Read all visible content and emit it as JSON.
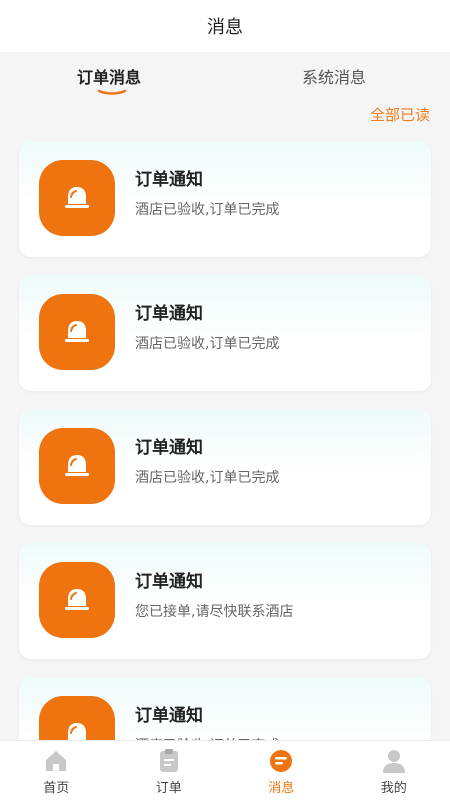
{
  "header": {
    "title": "消息"
  },
  "tabs": [
    {
      "label": "订单消息",
      "active": true
    },
    {
      "label": "系统消息",
      "active": false
    }
  ],
  "mark_all_read": "全部已读",
  "messages": [
    {
      "title": "订单通知",
      "desc": "酒店已验收,订单已完成",
      "icon": "bell-icon"
    },
    {
      "title": "订单通知",
      "desc": "酒店已验收,订单已完成",
      "icon": "bell-icon"
    },
    {
      "title": "订单通知",
      "desc": "酒店已验收,订单已完成",
      "icon": "bell-icon"
    },
    {
      "title": "订单通知",
      "desc": "您已接单,请尽快联系酒店",
      "icon": "bell-icon"
    },
    {
      "title": "订单通知",
      "desc": "酒店已验收,订单已完成",
      "icon": "bell-icon"
    }
  ],
  "tabbar": [
    {
      "label": "首页",
      "icon": "home-icon",
      "active": false
    },
    {
      "label": "订单",
      "icon": "order-icon",
      "active": false
    },
    {
      "label": "消息",
      "icon": "message-icon",
      "active": true
    },
    {
      "label": "我的",
      "icon": "profile-icon",
      "active": false
    }
  ],
  "colors": {
    "accent": "#ef730e",
    "mark_all": "#f07c1b"
  }
}
